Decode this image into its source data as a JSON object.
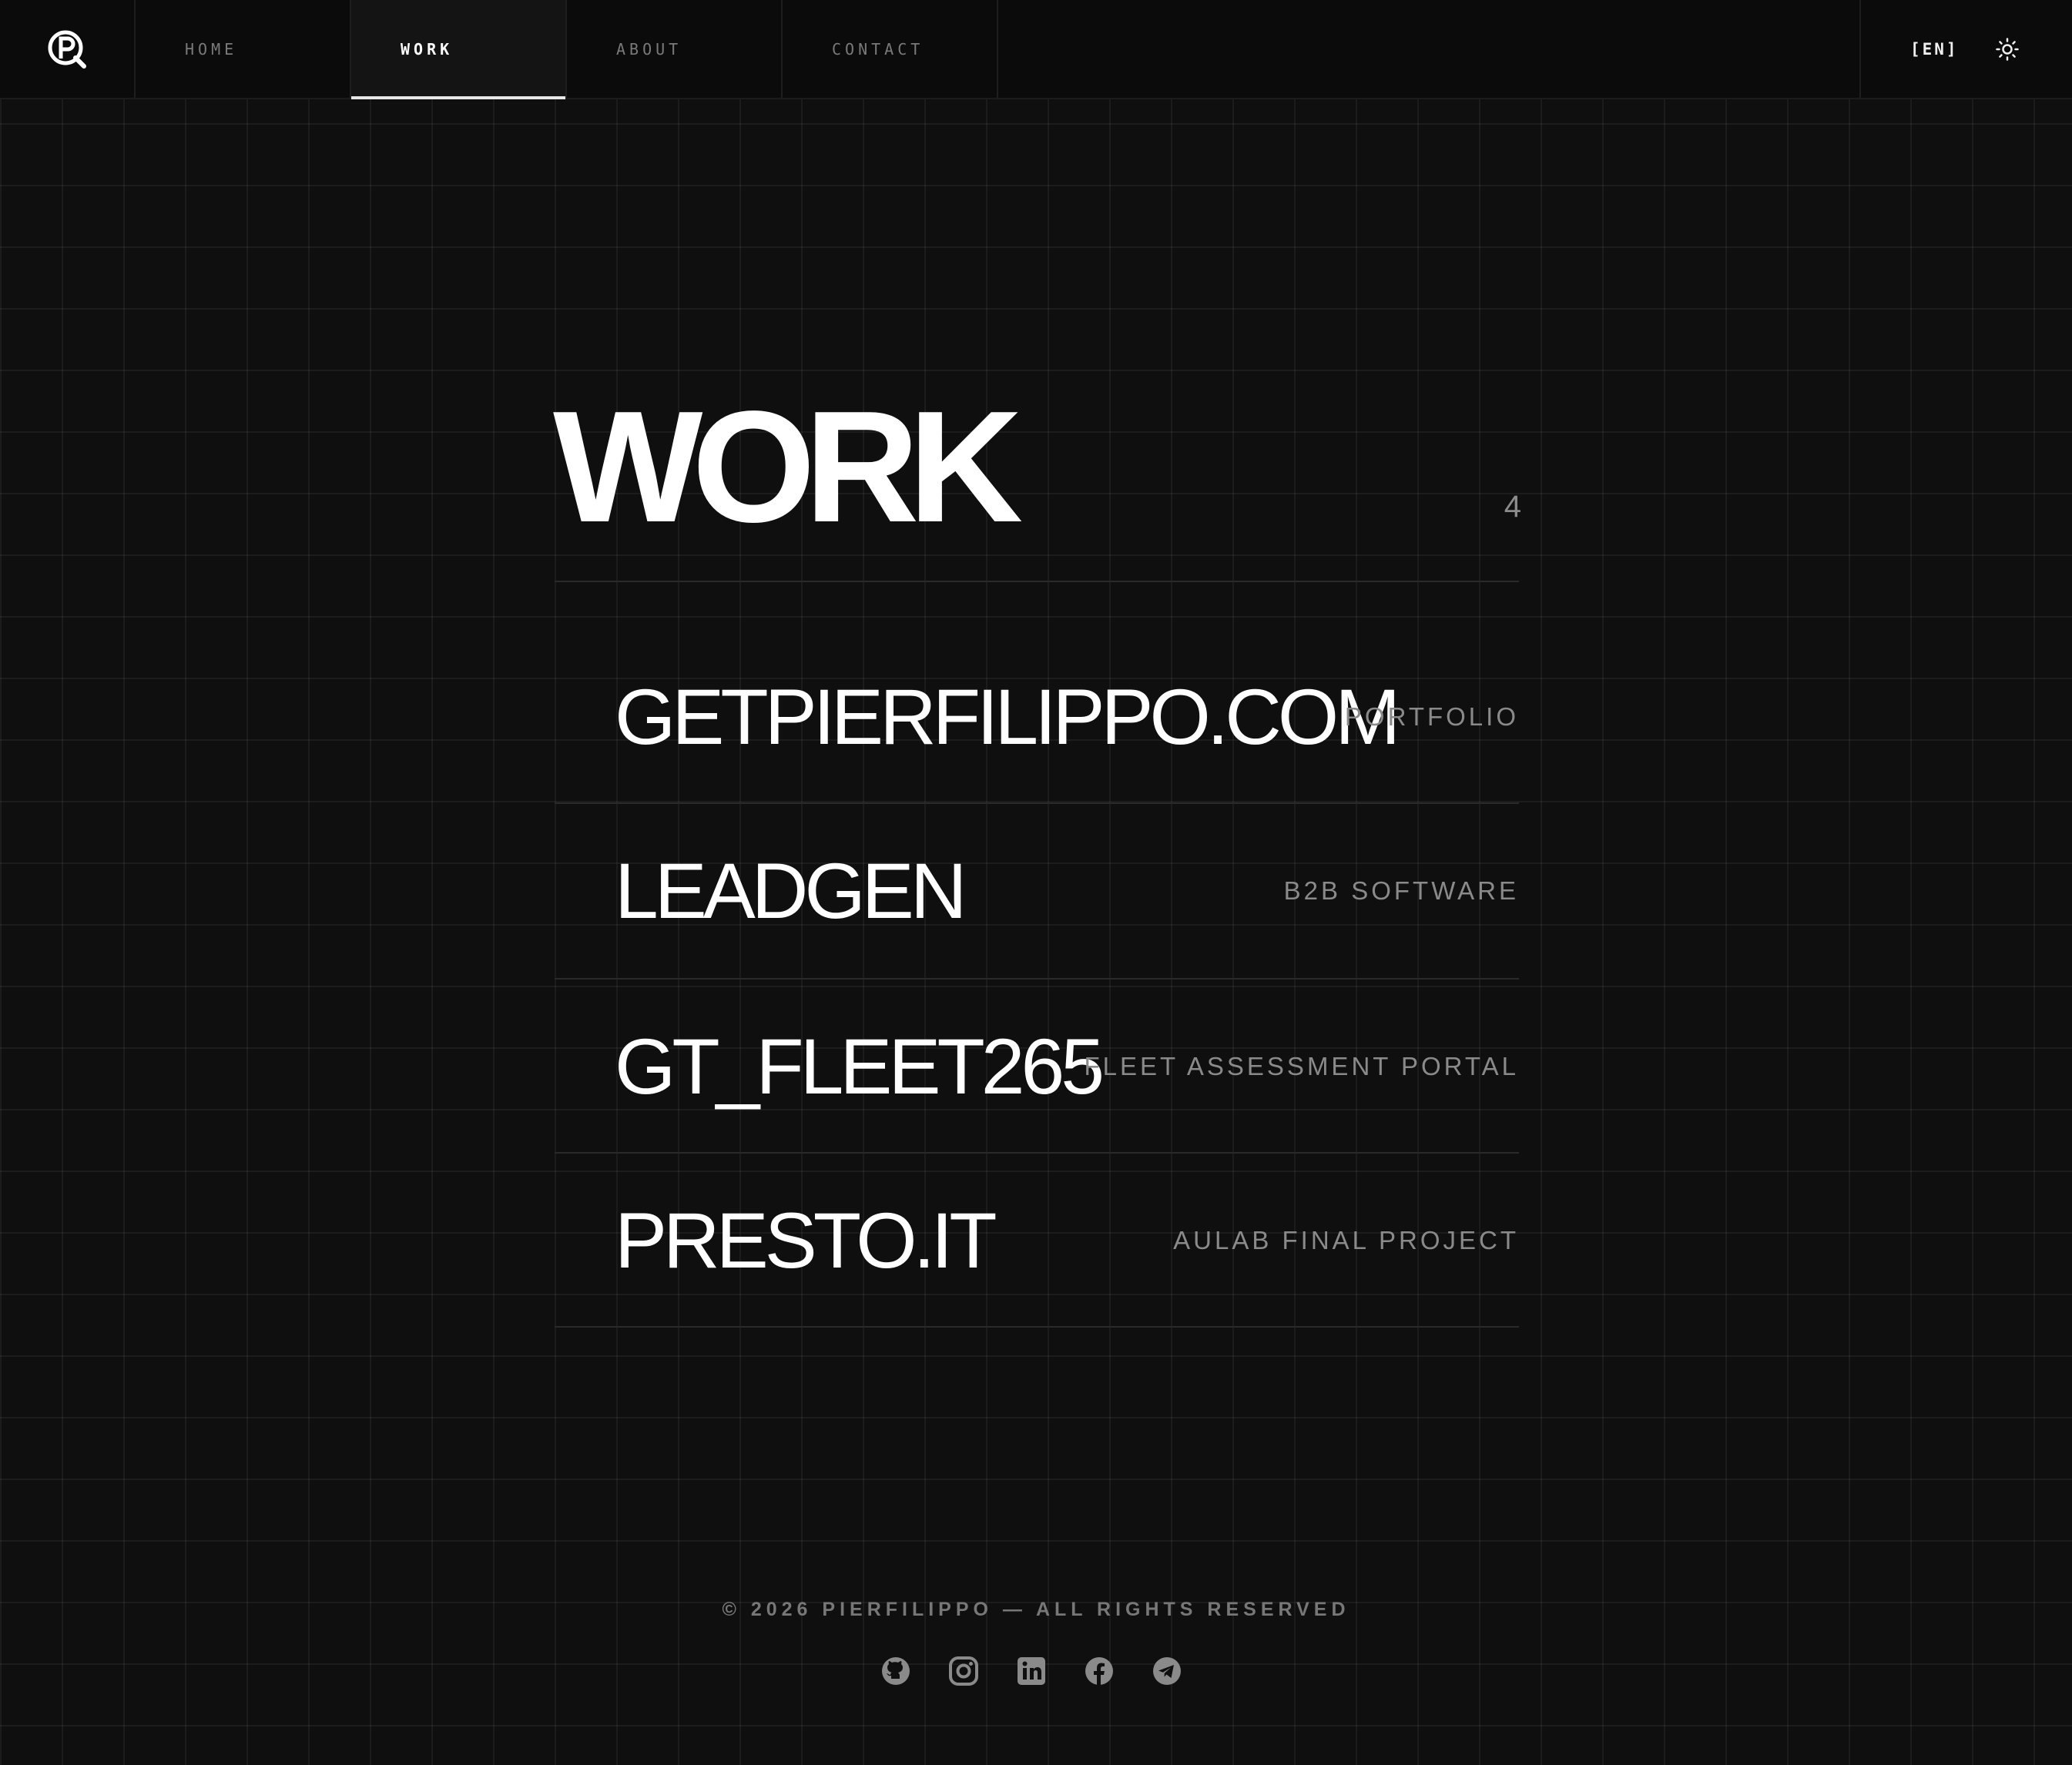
{
  "nav": {
    "tabs": [
      {
        "label": "HOME"
      },
      {
        "label": "WORK"
      },
      {
        "label": "ABOUT"
      },
      {
        "label": "CONTACT"
      }
    ],
    "active_tab": "WORK",
    "language": "[EN]"
  },
  "main": {
    "title": "WORK",
    "count": "4",
    "projects": [
      {
        "name": "GETPIERFILIPPO.COM",
        "category": "PORTFOLIO"
      },
      {
        "name": "LEADGEN",
        "category": "B2B SOFTWARE"
      },
      {
        "name": "GT_FLEET265",
        "category": "FLEET ASSESSMENT PORTAL"
      },
      {
        "name": "PRESTO.IT",
        "category": "AULAB FINAL PROJECT"
      }
    ]
  },
  "footer": {
    "copyright": "© 2026 PIERFILIPPO — ALL RIGHTS RESERVED",
    "social_icons": [
      "github-icon",
      "instagram-icon",
      "linkedin-icon",
      "facebook-icon",
      "telegram-icon"
    ]
  },
  "colors": {
    "background": "#0f0f0f",
    "text": "#ffffff",
    "muted": "#8a8a8a"
  }
}
